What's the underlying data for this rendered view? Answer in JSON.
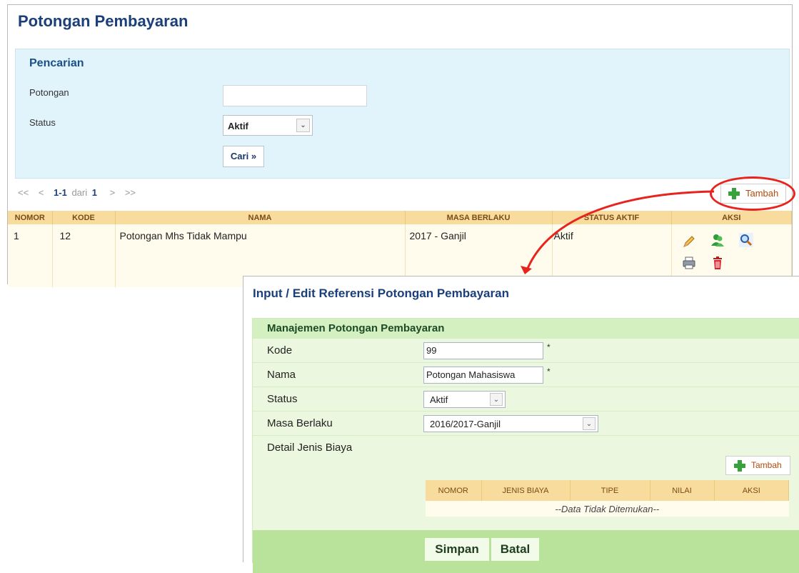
{
  "page": {
    "title": "Potongan Pembayaran"
  },
  "search": {
    "title": "Pencarian",
    "potongan_label": "Potongan",
    "potongan_value": "",
    "status_label": "Status",
    "status_value": "Aktif",
    "cari_label": "Cari »"
  },
  "pager": {
    "first": "<<",
    "prev": "<",
    "range": "1-1",
    "of": "dari",
    "total": "1",
    "next": ">",
    "last": ">>"
  },
  "toolbar": {
    "tambah_label": "Tambah"
  },
  "table": {
    "headers": [
      "NOMOR",
      "KODE",
      "NAMA",
      "MASA BERLAKU",
      "STATUS AKTIF",
      "AKSI"
    ],
    "rows": [
      {
        "nomor": "1",
        "kode": "12",
        "nama": "Potongan Mhs Tidak Mampu",
        "masa_berlaku": "2017 - Ganjil",
        "status_aktif": "Aktif"
      }
    ],
    "actions": [
      "edit-icon",
      "users-icon",
      "view-icon",
      "print-icon",
      "delete-icon"
    ]
  },
  "form": {
    "title": "Input / Edit Referensi Potongan Pembayaran",
    "section_title": "Manajemen Potongan Pembayaran",
    "kode_label": "Kode",
    "kode_value": "99",
    "nama_label": "Nama",
    "nama_value": "Potongan Mahasiswa",
    "status_label": "Status",
    "status_value": "Aktif",
    "masa_label": "Masa Berlaku",
    "masa_value": "2016/2017-Ganjil",
    "detail_label": "Detail Jenis Biaya",
    "required_mark": "*",
    "tambah_label": "Tambah",
    "detail_headers": [
      "NOMOR",
      "JENIS BIAYA",
      "TIPE",
      "NILAI",
      "AKSI"
    ],
    "empty_text": "--Data Tidak Ditemukan--",
    "simpan_label": "Simpan",
    "batal_label": "Batal"
  },
  "colors": {
    "title_blue": "#1b3f7a",
    "search_bg": "#e1f4fb",
    "table_header": "#f7dc9d",
    "form_bg": "#ebf8df",
    "button_bar": "#b9e39a",
    "highlight_red": "#e8231e"
  }
}
